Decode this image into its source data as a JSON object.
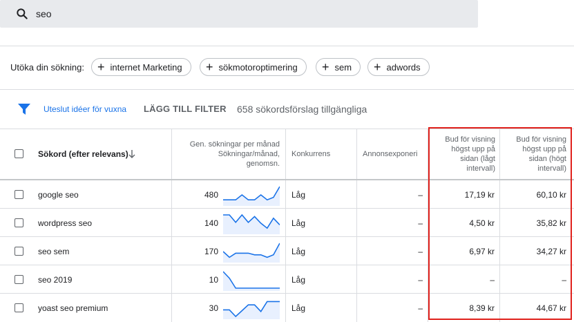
{
  "search": {
    "query": "seo"
  },
  "expand": {
    "label": "Utöka din sökning:",
    "chips": [
      "internet Marketing",
      "sökmotoroptimering",
      "sem",
      "adwords"
    ]
  },
  "filterbar": {
    "exclude_label": "Uteslut idéer för vuxna",
    "add_filter_label": "LÄGG TILL FILTER",
    "count_label": "658 sökordsförslag tillgängliga"
  },
  "table": {
    "headers": {
      "keyword": "Sökord (efter relevans)",
      "searches": [
        "Gen. sökningar per månad",
        "Sökningar/månad,",
        "genomsn."
      ],
      "competition": "Konkurrens",
      "impression": "Annonsexponeri",
      "bid_low": [
        "Bud för visning",
        "högst upp på",
        "sidan (lågt",
        "intervall)"
      ],
      "bid_high": [
        "Bud för visning",
        "högst upp på",
        "sidan (högt",
        "intervall)"
      ]
    },
    "rows": [
      {
        "keyword": "google seo",
        "searches": "480",
        "competition": "Låg",
        "impression": "–",
        "bid_low": "17,19 kr",
        "bid_high": "60,10 kr",
        "trend": [
          0.2,
          0.2,
          0.2,
          0.5,
          0.2,
          0.2,
          0.5,
          0.2,
          0.35,
          1.0
        ]
      },
      {
        "keyword": "wordpress seo",
        "searches": "140",
        "competition": "Låg",
        "impression": "–",
        "bid_low": "4,50 kr",
        "bid_high": "35,82 kr",
        "trend": [
          1.0,
          1.0,
          0.55,
          1.0,
          0.55,
          0.9,
          0.5,
          0.2,
          0.8,
          0.4
        ]
      },
      {
        "keyword": "seo sem",
        "searches": "170",
        "competition": "Låg",
        "impression": "–",
        "bid_low": "6,97 kr",
        "bid_high": "34,27 kr",
        "trend": [
          0.5,
          0.15,
          0.4,
          0.4,
          0.4,
          0.3,
          0.3,
          0.15,
          0.3,
          1.0
        ]
      },
      {
        "keyword": "seo 2019",
        "searches": "10",
        "competition": "Låg",
        "impression": "–",
        "bid_low": "–",
        "bid_high": "–",
        "trend": [
          1.0,
          0.6,
          0.0,
          0.0,
          0.0,
          0.0,
          0.0,
          0.0,
          0.0,
          0.0
        ]
      },
      {
        "keyword": "yoast seo premium",
        "searches": "30",
        "competition": "Låg",
        "impression": "–",
        "bid_low": "8,39 kr",
        "bid_high": "44,67 kr",
        "trend": [
          0.4,
          0.4,
          0.0,
          0.35,
          0.7,
          0.7,
          0.3,
          0.9,
          0.9,
          0.9
        ]
      }
    ]
  },
  "colors": {
    "accent": "#1a73e8",
    "highlight": "#e0201b",
    "spark_fill": "#e8f0fe"
  }
}
